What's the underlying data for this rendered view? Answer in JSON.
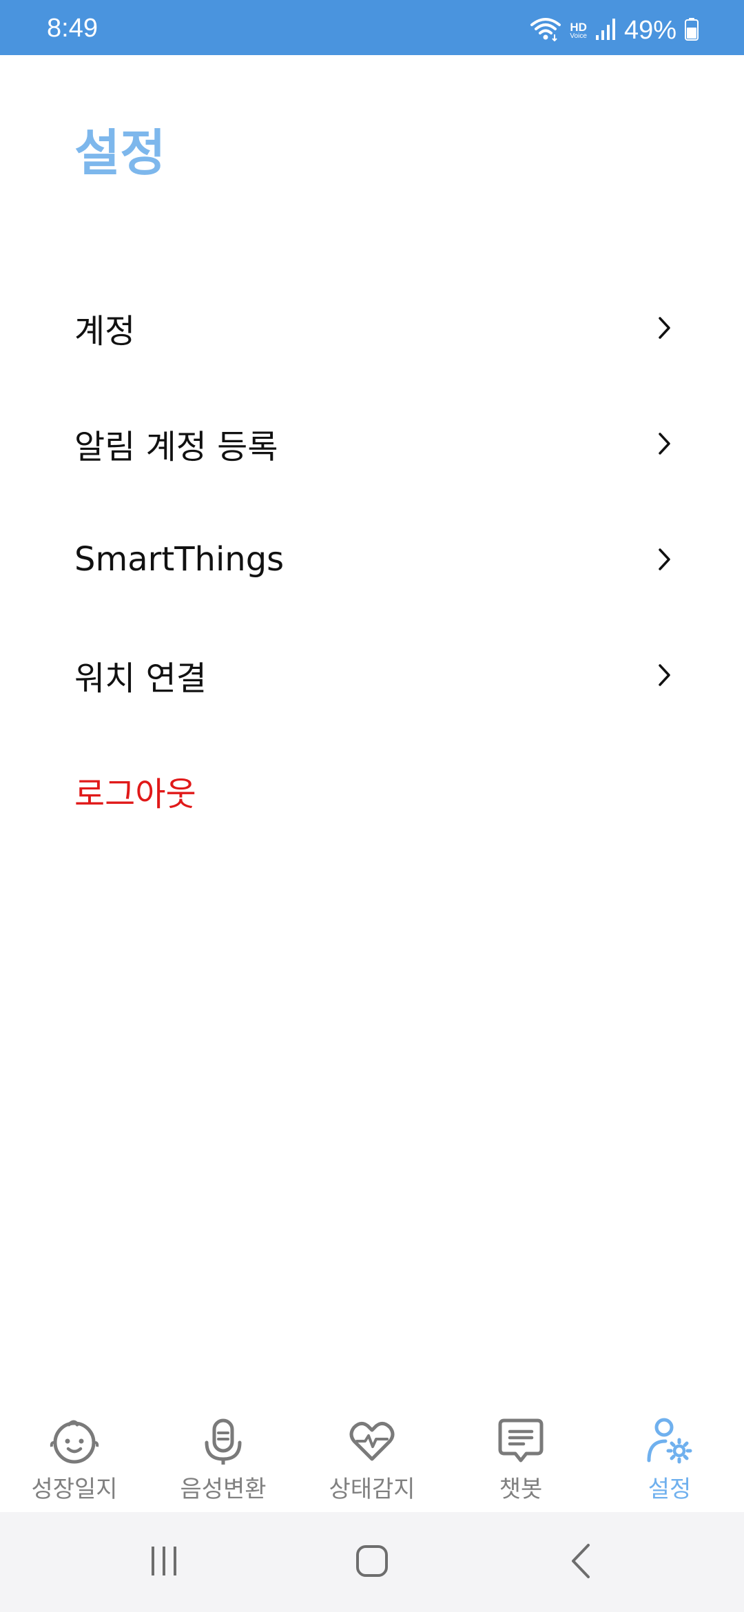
{
  "status_bar": {
    "time": "8:49",
    "hd_label": "HD",
    "voice_label": "Voice",
    "battery": "49%",
    "icons": [
      "wifi-icon",
      "signal-icon",
      "battery-icon"
    ]
  },
  "page": {
    "title": "설정"
  },
  "menu": {
    "items": [
      {
        "label": "계정",
        "icon": "chevron-right-icon"
      },
      {
        "label": "알림 계정 등록",
        "icon": "chevron-right-icon"
      },
      {
        "label": "SmartThings",
        "icon": "chevron-right-icon"
      },
      {
        "label": "워치 연결",
        "icon": "chevron-right-icon"
      }
    ],
    "logout_label": "로그아웃"
  },
  "bottom_nav": {
    "items": [
      {
        "label": "성장일지",
        "icon": "baby-face-icon"
      },
      {
        "label": "음성변환",
        "icon": "microphone-icon"
      },
      {
        "label": "상태감지",
        "icon": "heart-pulse-icon"
      },
      {
        "label": "챗봇",
        "icon": "chat-bubble-icon"
      },
      {
        "label": "설정",
        "icon": "user-settings-icon"
      }
    ],
    "active_index": 4
  },
  "system_nav": {
    "icons": [
      "recent-apps-icon",
      "home-icon",
      "back-icon"
    ]
  },
  "colors": {
    "status_bar": "#4a94de",
    "accent": "#7db7ec",
    "logout": "#e01919",
    "inactive_nav": "#808080",
    "system_nav_bg": "#f4f4f6"
  }
}
